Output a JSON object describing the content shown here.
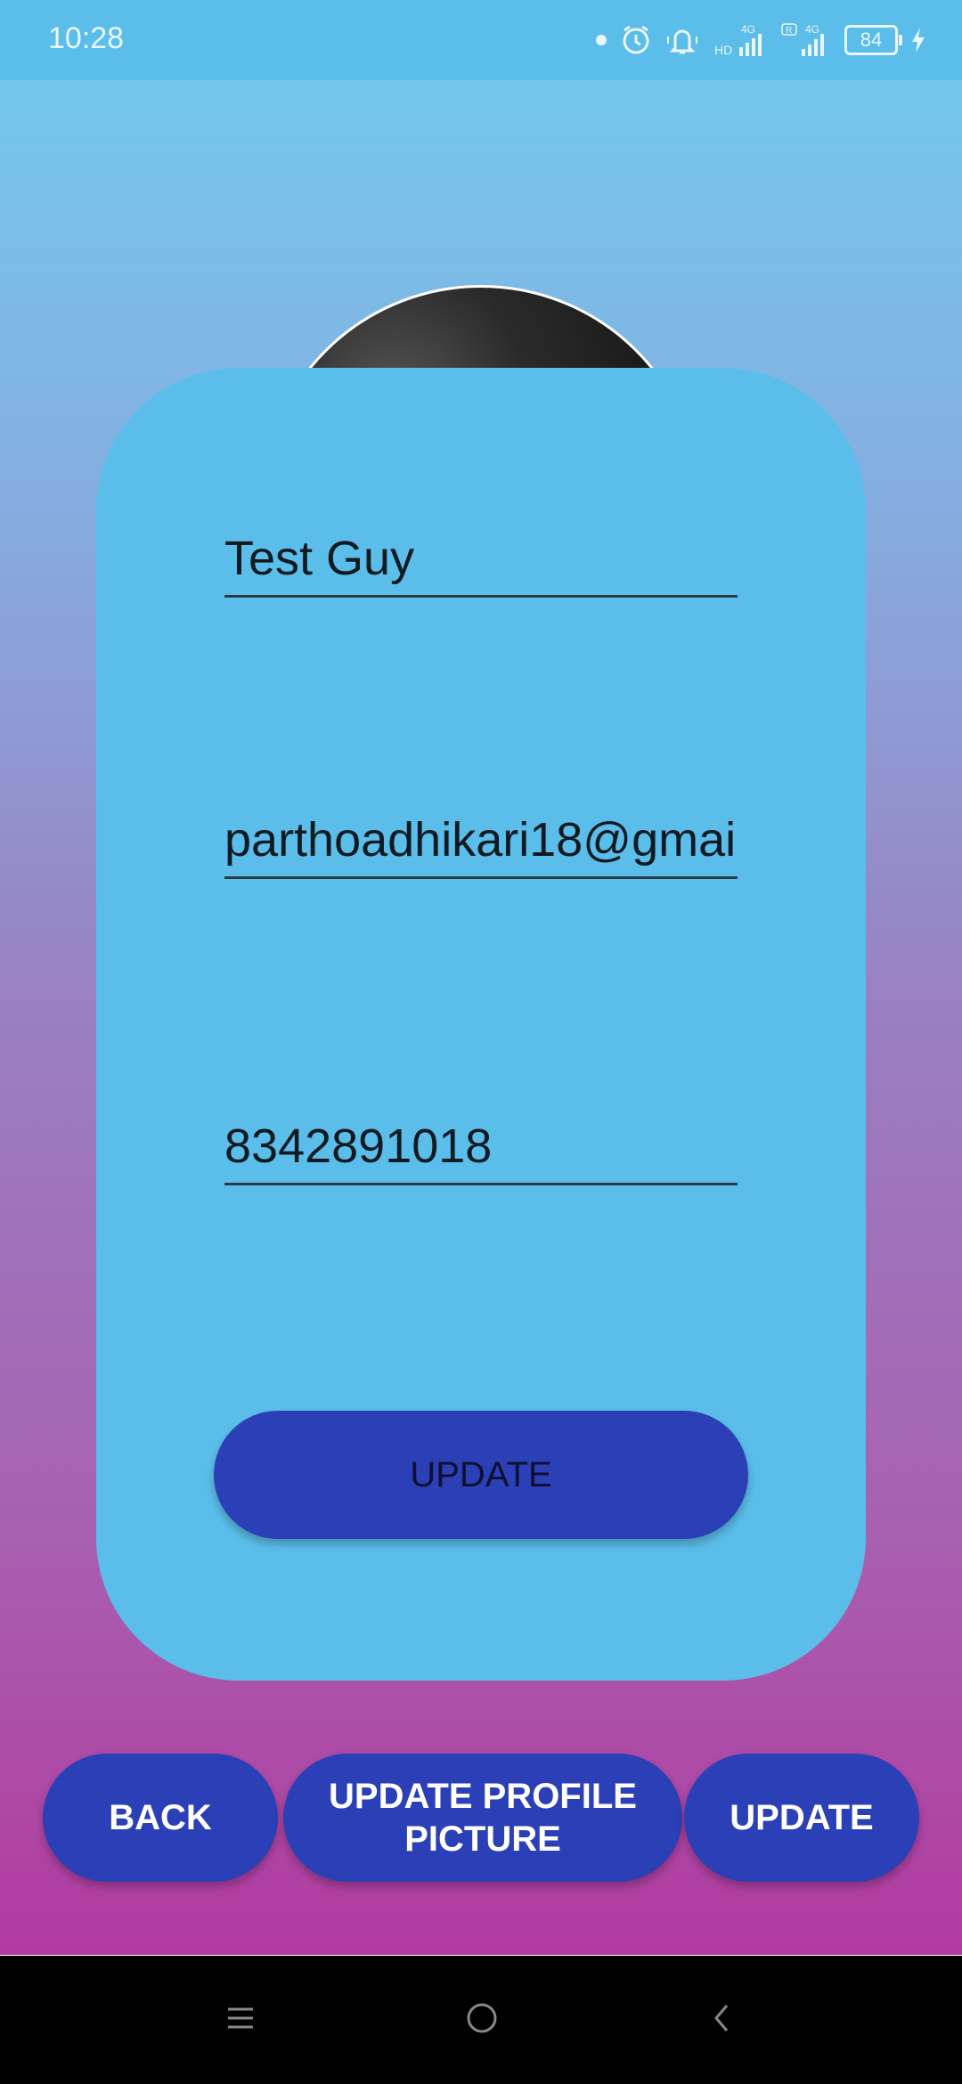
{
  "status_bar": {
    "time": "10:28",
    "battery": "84",
    "icons": [
      "notification-dot-icon",
      "alarm-icon",
      "vibrate-icon",
      "signal-hd-4g-icon",
      "signal-r-4g-icon",
      "battery-icon",
      "charging-icon"
    ]
  },
  "profile": {
    "name_value": "Test Guy",
    "email_value": "parthoadhikari18@gmai",
    "phone_value": "8342891018",
    "update_button_label": "UPDATE"
  },
  "bottom_buttons": {
    "back_label": "BACK",
    "update_picture_label": "UPDATE PROFILE PICTURE",
    "update_label": "UPDATE"
  },
  "nav_bar": {
    "icons": [
      "menu-icon",
      "home-icon",
      "back-icon"
    ]
  },
  "colors": {
    "status_bar": "#5bbde9",
    "card": "#5bbeea",
    "button": "#2b3fb6",
    "gradient_top": "#74c7ec",
    "gradient_bottom": "#b23aa0"
  }
}
